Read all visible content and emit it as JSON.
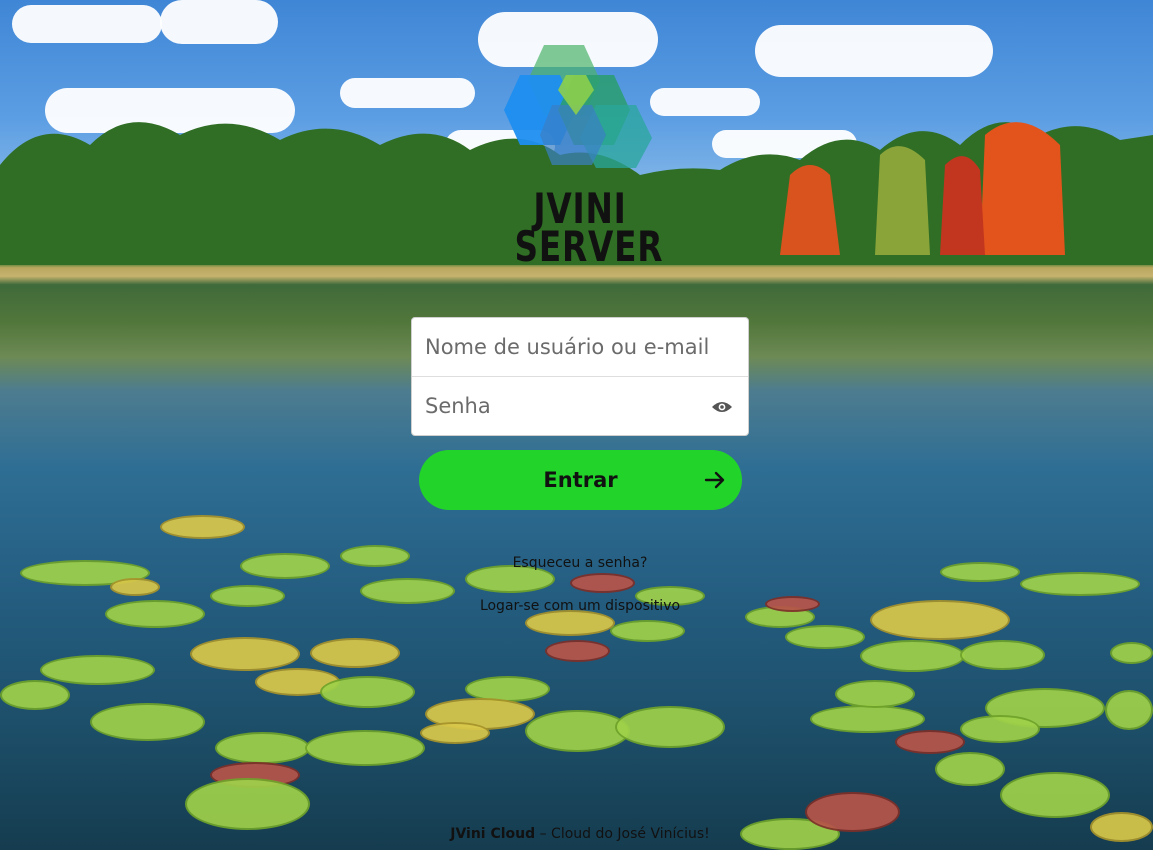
{
  "logo": {
    "line1": "JVINI",
    "line2": "SERVER",
    "colors": [
      "#2b8ae6",
      "#4bb36a",
      "#78c25a",
      "#2a9d8f"
    ]
  },
  "form": {
    "username_placeholder": "Nome de usuário ou e-mail",
    "password_placeholder": "Senha",
    "username_value": "",
    "password_value": "",
    "toggle_icon": "eye-icon"
  },
  "login_button": {
    "label": "Entrar",
    "icon": "arrow-right-icon",
    "color": "#22d42a"
  },
  "links": {
    "forgot_password": "Esqueceu a senha?",
    "device_login": "Logar-se com um dispositivo"
  },
  "footer": {
    "brand": "JVini Cloud",
    "tagline": " – Cloud do José Vinícius!"
  }
}
